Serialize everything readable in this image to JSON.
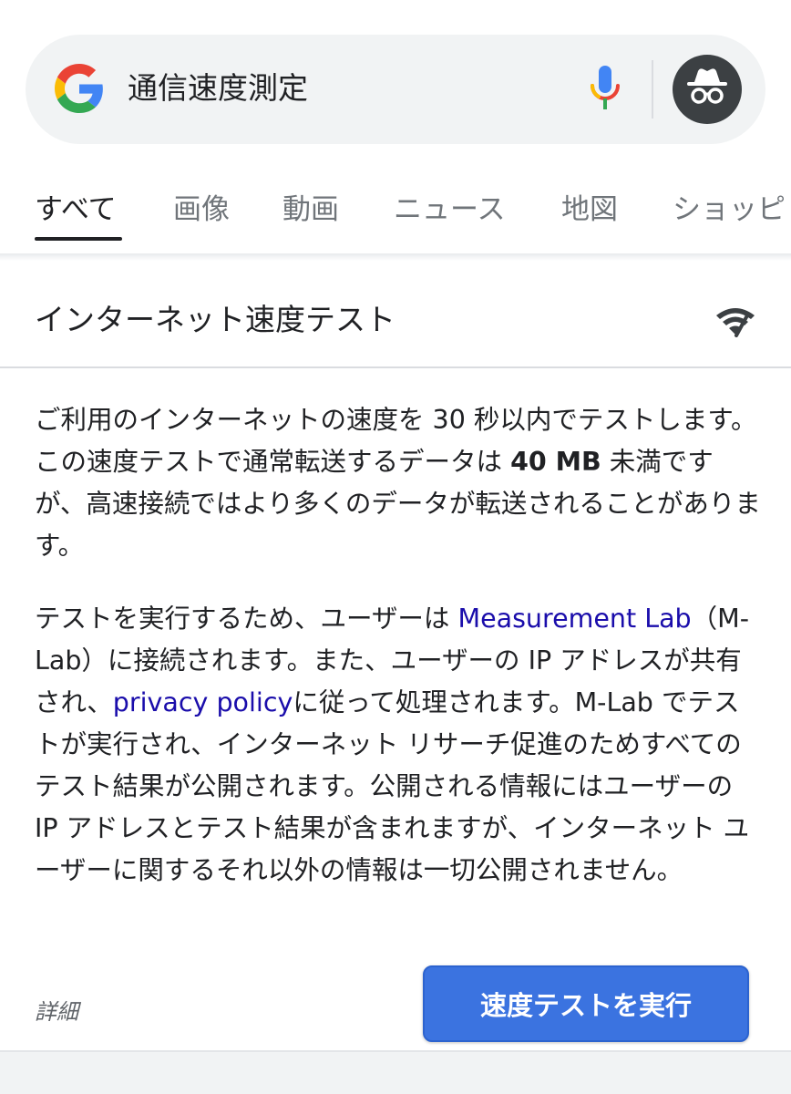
{
  "search": {
    "query": "通信速度測定",
    "icons": [
      "google-g-icon",
      "microphone-icon",
      "incognito-icon"
    ]
  },
  "tabs": [
    {
      "label": "すべて",
      "active": true
    },
    {
      "label": "画像",
      "active": false
    },
    {
      "label": "動画",
      "active": false
    },
    {
      "label": "ニュース",
      "active": false
    },
    {
      "label": "地図",
      "active": false
    },
    {
      "label": "ショッピ",
      "active": false
    }
  ],
  "card": {
    "title": "インターネット速度テスト",
    "icon": "wifi-speed-icon",
    "para1": {
      "text_before": "ご利用のインターネットの速度を 30 秒以内でテストします。この速度テストで通常転送するデータは ",
      "bold": "40 MB",
      "text_after": " 未満ですが、高速接続ではより多くのデータが転送されることがあります。"
    },
    "para2": {
      "text1": "テストを実行するため、ユーザーは ",
      "link1": "Measurement Lab",
      "text2": "（M-Lab）に接続されます。また、ユーザーの IP アドレスが共有され、",
      "link2": "privacy policy",
      "text3": "に従って処理されます。M-Lab でテストが実行され、インターネット リサーチ促進のためすべてのテスト結果が公開されます。公開される情報にはユーザーの IP アドレスとテスト結果が含まれますが、インターネット ユーザーに関するそれ以外の情報は一切公開されません。"
    },
    "details_label": "詳細",
    "run_button_label": "速度テストを実行"
  },
  "colors": {
    "link": "#1a0dab",
    "button": "#3b73e0",
    "search_bg": "#f1f3f4"
  }
}
